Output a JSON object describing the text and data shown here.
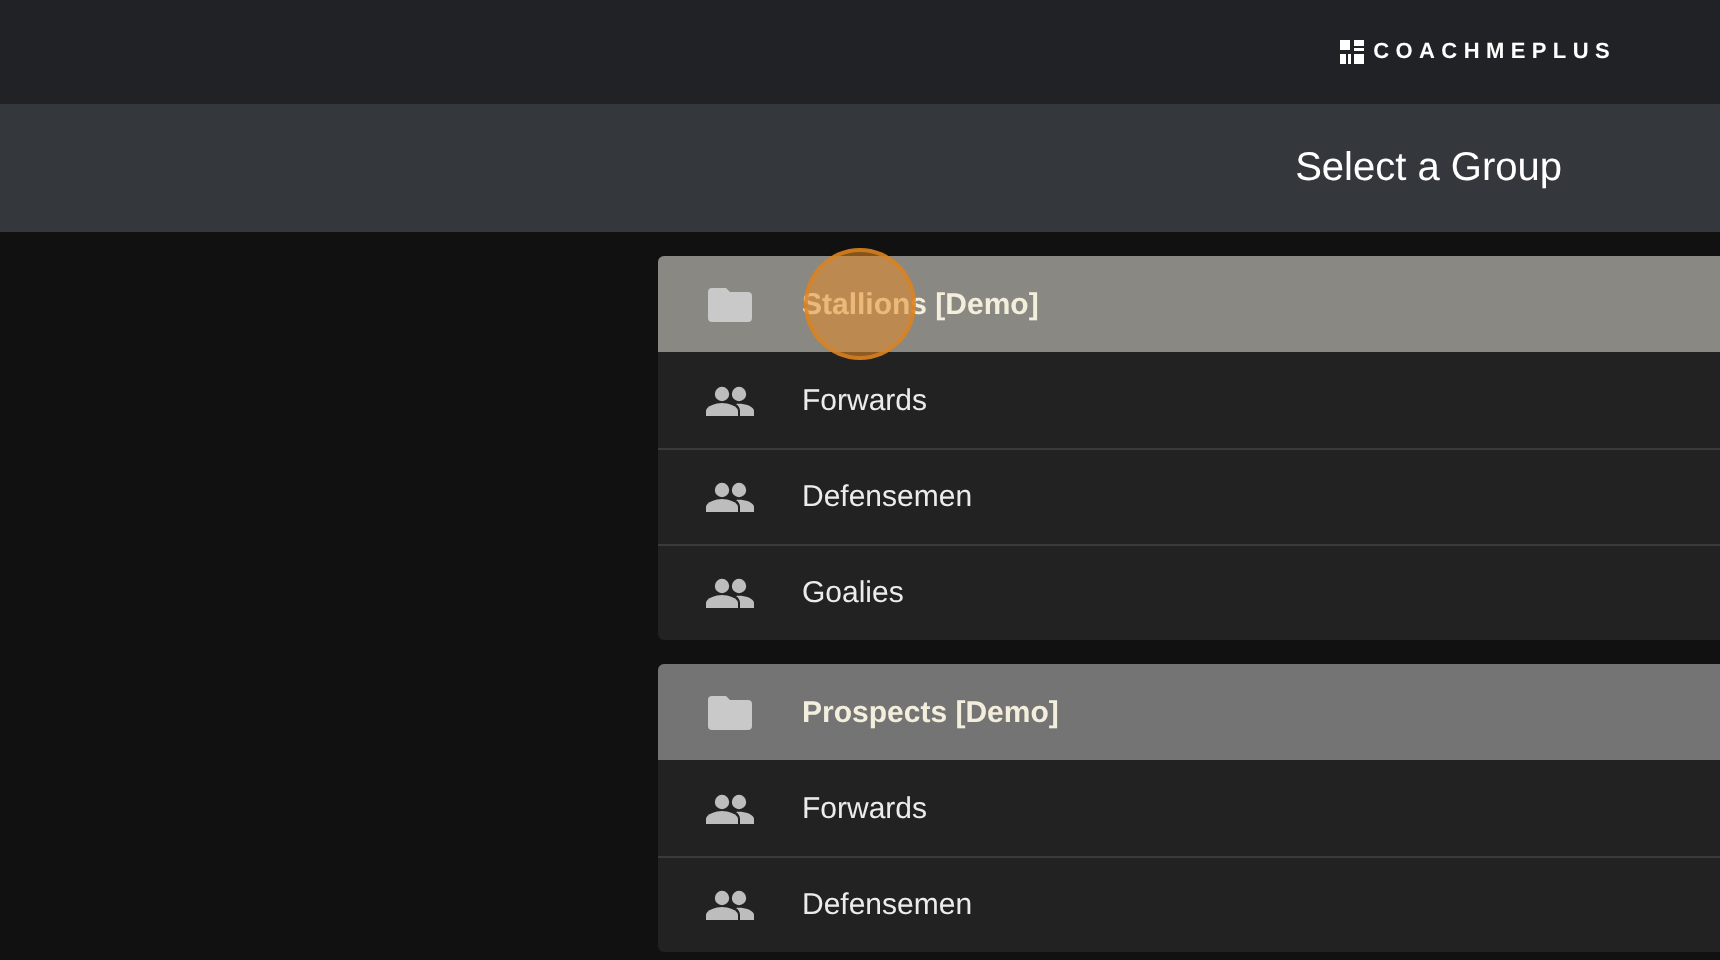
{
  "brand": {
    "name": "COACHMEPLUS"
  },
  "page_title": "Select a Group",
  "groups": [
    {
      "name": "Stallions [Demo]",
      "highlighted": true,
      "items": [
        {
          "label": "Forwards"
        },
        {
          "label": "Defensemen"
        },
        {
          "label": "Goalies"
        }
      ]
    },
    {
      "name": "Prospects [Demo]",
      "highlighted": false,
      "items": [
        {
          "label": "Forwards"
        },
        {
          "label": "Defensemen"
        }
      ]
    }
  ]
}
